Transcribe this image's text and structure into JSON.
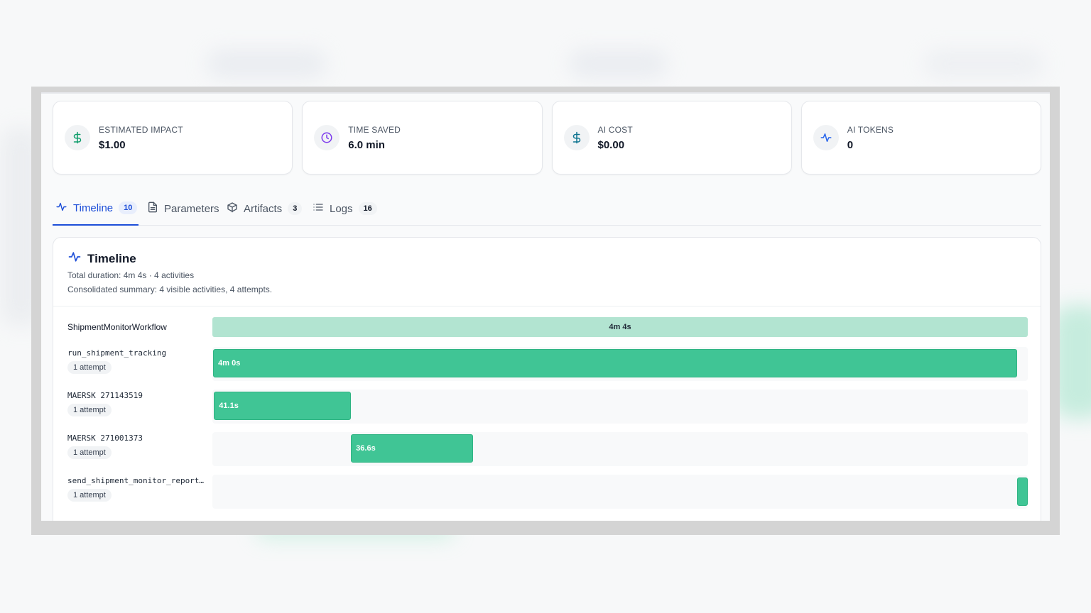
{
  "stats": [
    {
      "label": "ESTIMATED IMPACT",
      "value": "$1.00",
      "icon": "dollar-icon",
      "color": "#0f9d6b"
    },
    {
      "label": "TIME SAVED",
      "value": "6.0 min",
      "icon": "clock-icon",
      "color": "#7c3aed"
    },
    {
      "label": "AI COST",
      "value": "$0.00",
      "icon": "dollar-icon",
      "color": "#0e7490"
    },
    {
      "label": "AI TOKENS",
      "value": "0",
      "icon": "activity-icon",
      "color": "#2563eb"
    }
  ],
  "tabs": [
    {
      "label": "Timeline",
      "count": "10",
      "icon": "activity-icon",
      "active": true
    },
    {
      "label": "Parameters",
      "count": "",
      "icon": "document-icon"
    },
    {
      "label": "Artifacts",
      "count": "3",
      "icon": "box-icon"
    },
    {
      "label": "Logs",
      "count": "16",
      "icon": "list-icon"
    }
  ],
  "timeline": {
    "title": "Timeline",
    "summary": "Total duration: 4m 4s · 4 activities",
    "consolidated": "Consolidated summary: 4 visible activities, 4 attempts.",
    "accent": "#40c595",
    "rows": [
      {
        "name": "ShipmentMonitorWorkflow",
        "duration": "4m 4s",
        "start_fraction": 0.0,
        "duration_fraction": 1.0
      },
      {
        "name": "run_shipment_tracking",
        "attempts": "1 attempt",
        "duration": "4m 0s",
        "start_fraction": 0.001,
        "duration_fraction": 0.986
      },
      {
        "name": "MAERSK 271143519",
        "attempts": "1 attempt",
        "duration": "41.1s",
        "start_fraction": 0.002,
        "duration_fraction": 0.168
      },
      {
        "name": "MAERSK 271001373",
        "attempts": "1 attempt",
        "duration": "36.6s",
        "start_fraction": 0.17,
        "duration_fraction": 0.15
      },
      {
        "name": "send_shipment_monitor_report…",
        "attempts": "1 attempt",
        "duration": "",
        "start_fraction": 0.987,
        "duration_fraction": 0.013
      }
    ]
  }
}
